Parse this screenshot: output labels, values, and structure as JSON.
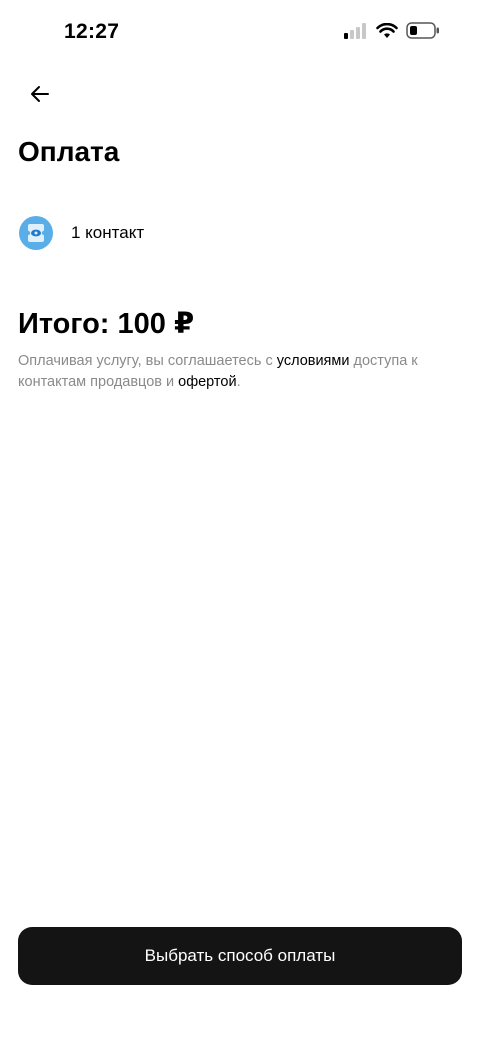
{
  "status_bar": {
    "time": "12:27"
  },
  "header": {
    "back_icon": "arrow-left-icon",
    "title": "Оплата"
  },
  "order": {
    "item_icon": "contact-ticket-icon",
    "item_label": "1 контакт"
  },
  "summary": {
    "total": "Итого: 100 ₽",
    "terms_prefix": "Оплачивая услугу, вы соглашаетесь с ",
    "terms_link": "условиями",
    "terms_middle": " доступа к контактам продавцов и ",
    "offer_link": "офертой",
    "terms_suffix": "."
  },
  "actions": {
    "pay_label": "Выбрать способ оплаты"
  },
  "colors": {
    "button_bg": "#141414",
    "muted_text": "#8a8a8a",
    "icon_blue": "#5aaee8"
  }
}
